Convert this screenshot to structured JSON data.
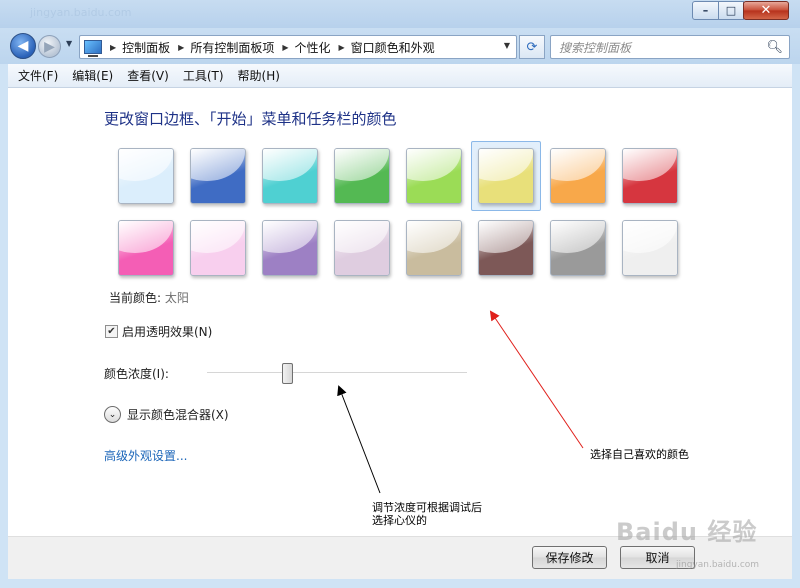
{
  "window": {
    "title_ghost": "jingyan.baidu.com",
    "caption_buttons": {
      "minimize_glyph": "–",
      "maximize_glyph": "□",
      "close_glyph": "✕"
    }
  },
  "nav": {
    "back_glyph": "◀",
    "forward_glyph": "▶",
    "dropdown_glyph": "▼",
    "breadcrumbs": [
      "控制面板",
      "所有控制面板项",
      "个性化",
      "窗口颜色和外观"
    ],
    "separator_glyph": "▶",
    "refresh_glyph": "⟳",
    "search_placeholder": "搜索控制面板",
    "search_icon": "search-icon"
  },
  "menu": [
    "文件(F)",
    "编辑(E)",
    "查看(V)",
    "工具(T)",
    "帮助(H)"
  ],
  "content": {
    "heading": "更改窗口边框、「开始」菜单和任务栏的颜色",
    "swatches": [
      {
        "name": "sky",
        "color": "#dbeefc"
      },
      {
        "name": "twilight",
        "color": "#3f6cc4"
      },
      {
        "name": "sea",
        "color": "#4fd0d2"
      },
      {
        "name": "leaf",
        "color": "#54b953"
      },
      {
        "name": "lime",
        "color": "#9bdc56"
      },
      {
        "name": "sun",
        "color": "#e8e07a"
      },
      {
        "name": "pumpkin",
        "color": "#f8a84a"
      },
      {
        "name": "ruby",
        "color": "#d6363f"
      },
      {
        "name": "fuchsia",
        "color": "#f45eb5"
      },
      {
        "name": "blush",
        "color": "#f8cfee"
      },
      {
        "name": "violet",
        "color": "#9d80c4"
      },
      {
        "name": "lavender",
        "color": "#dfcde0"
      },
      {
        "name": "taupe",
        "color": "#c9bc9e"
      },
      {
        "name": "chocolate",
        "color": "#7d5857"
      },
      {
        "name": "slate",
        "color": "#9a9a9a"
      },
      {
        "name": "frost",
        "color": "#efefef"
      }
    ],
    "selected_swatch_index": 5,
    "current_color_label": "当前颜色:",
    "current_color_value": "太阳",
    "transparency_label": "启用透明效果(N)",
    "transparency_checked": true,
    "check_glyph": "✔",
    "intensity_label": "颜色浓度(I):",
    "intensity_fraction": 0.31,
    "mixer_toggle_glyph": "⌄",
    "mixer_label": "显示颜色混合器(X)",
    "advanced_link": "高级外观设置..."
  },
  "annotations": {
    "color_note": "选择自己喜欢的颜色",
    "intensity_note_line1": "调节浓度可根据调试后",
    "intensity_note_line2": "选择心仪的"
  },
  "footer": {
    "save_label": "保存修改",
    "cancel_label": "取消"
  },
  "watermark": {
    "text": "Baidu 经验",
    "sub": "jingyan.baidu.com"
  }
}
